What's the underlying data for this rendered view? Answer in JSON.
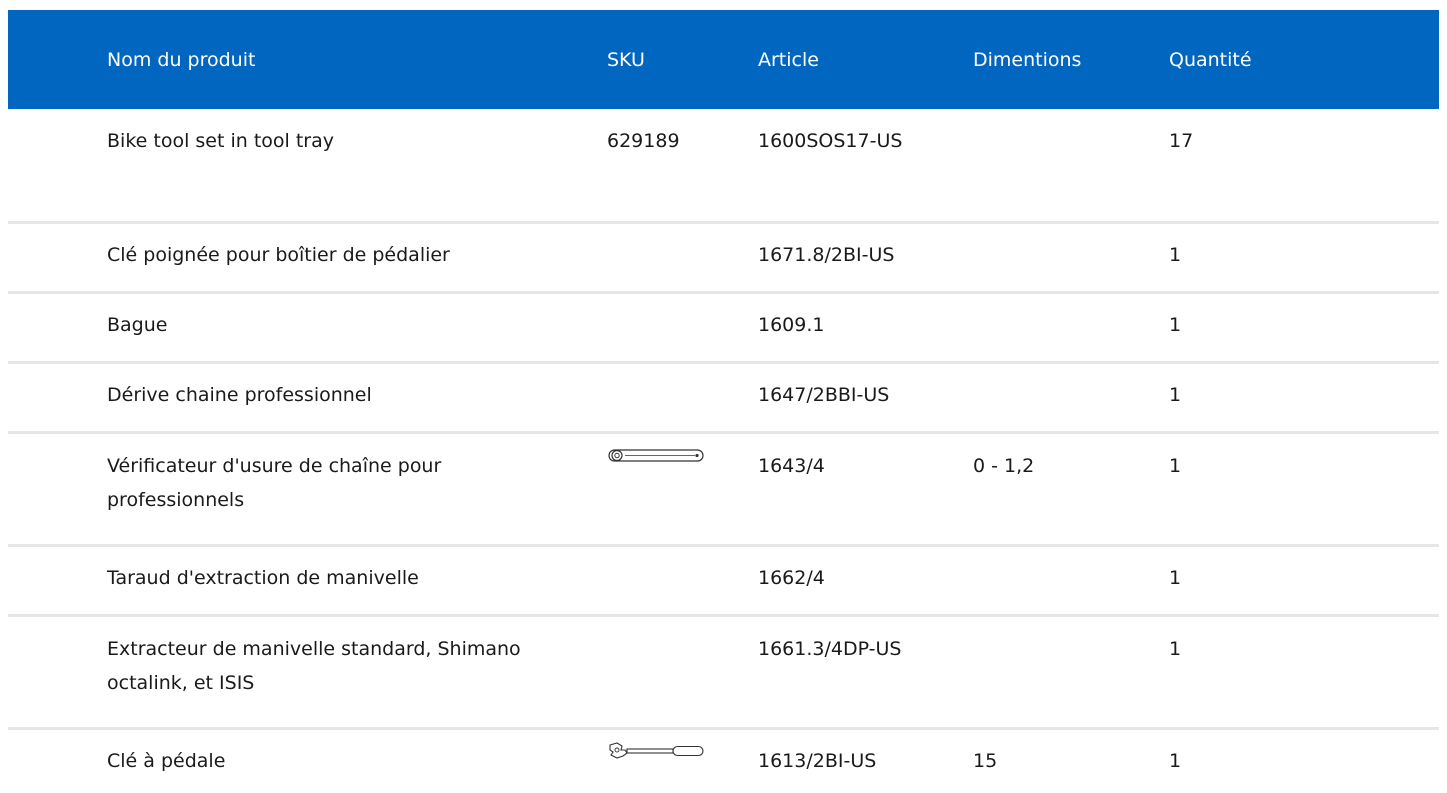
{
  "table": {
    "headers": {
      "name": "Nom du produit",
      "sku": "SKU",
      "article": "Article",
      "dimensions": "Dimentions",
      "quantity": "Quantité"
    },
    "rows": [
      {
        "name": "Bike tool set in tool tray",
        "sku": "629189",
        "sku_icon": "",
        "article": "1600SOS17-US",
        "dimensions": "",
        "quantity": "17"
      },
      {
        "name": "Clé poignée pour boîtier de pédalier",
        "sku": "",
        "sku_icon": "",
        "article": "1671.8/2BI-US",
        "dimensions": "",
        "quantity": "1"
      },
      {
        "name": "Bague",
        "sku": "",
        "sku_icon": "",
        "article": "1609.1",
        "dimensions": "",
        "quantity": "1"
      },
      {
        "name": "Dérive chaine professionnel",
        "sku": "",
        "sku_icon": "",
        "article": "1647/2BBI-US",
        "dimensions": "",
        "quantity": "1"
      },
      {
        "name": "Vérificateur d'usure de chaîne pour professionnels",
        "sku": "",
        "sku_icon": "chain-wear-gauge-icon",
        "article": "1643/4",
        "dimensions": "0 - 1,2",
        "quantity": "1"
      },
      {
        "name": "Taraud d'extraction de manivelle",
        "sku": "",
        "sku_icon": "",
        "article": "1662/4",
        "dimensions": "",
        "quantity": "1"
      },
      {
        "name": "Extracteur de manivelle standard, Shimano octalink, et ISIS",
        "sku": "",
        "sku_icon": "",
        "article": "1661.3/4DP-US",
        "dimensions": "",
        "quantity": "1"
      },
      {
        "name": "Clé à pédale",
        "sku": "",
        "sku_icon": "pedal-wrench-icon",
        "article": "1613/2BI-US",
        "dimensions": "15",
        "quantity": "1"
      }
    ]
  },
  "colors": {
    "header_bg": "#0066c0",
    "header_text": "#ffffff",
    "row_divider": "#e6e6e6"
  }
}
